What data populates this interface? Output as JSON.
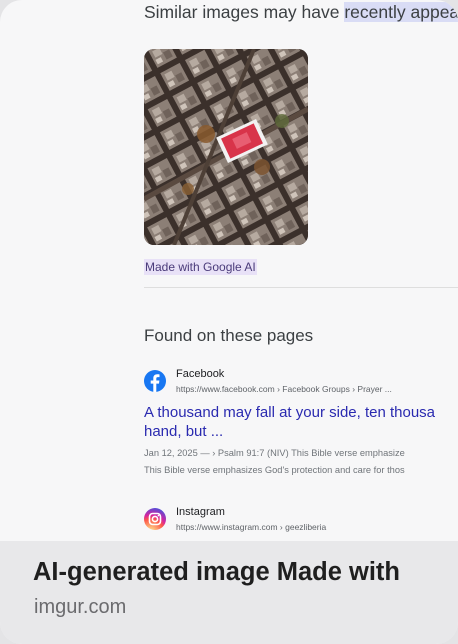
{
  "similar": {
    "text_before": "Similar images may have ",
    "text_highlight": "recently appea"
  },
  "thumbnail": {
    "label": "Made with Google AI"
  },
  "found": {
    "title": "Found on these pages",
    "results": [
      {
        "site": "Facebook",
        "url": "https://www.facebook.com › Facebook Groups › Prayer ...",
        "title_line1": "A thousand may fall at your side, ten thousa",
        "title_line2": "hand, but ...",
        "snippet_line1": "Jan 12, 2025 — › Psalm 91:7 (NIV) This Bible verse emphasize",
        "snippet_line2": "This Bible verse emphasizes God's protection and care for thos",
        "icon": "facebook-icon",
        "icon_color": "#1877f2"
      },
      {
        "site": "Instagram",
        "url": "https://www.instagram.com › geezliberia",
        "icon": "instagram-icon"
      }
    ]
  },
  "footer": {
    "title": "AI-generated image Made with",
    "domain": "imgur.com"
  }
}
